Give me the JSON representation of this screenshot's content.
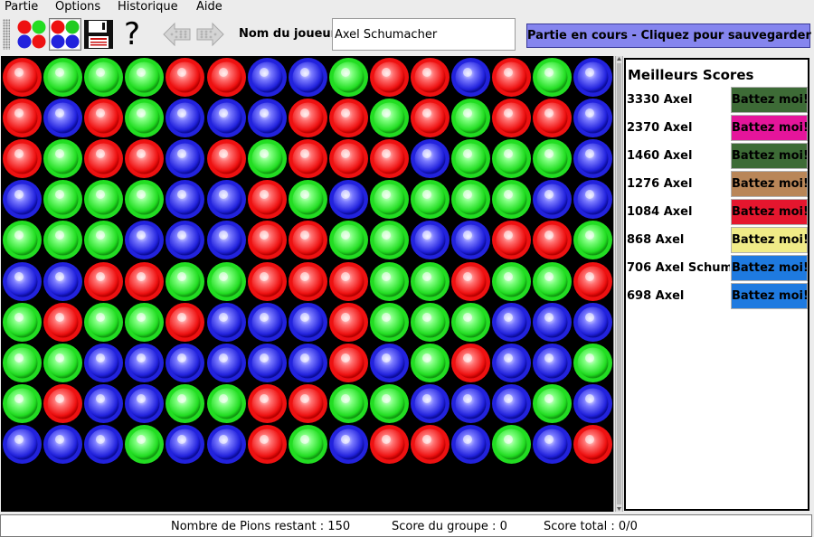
{
  "menu": [
    "Partie",
    "Options",
    "Historique",
    "Aide"
  ],
  "toolbar": {
    "player_label": "Nom du joueur",
    "player_name": "Axel Schumacher",
    "status_button": "Partie en cours - Cliquez pour sauvegarder",
    "help_glyph": "?"
  },
  "icons": {
    "new_game": "colored-balls-icon",
    "options": "color-grid-icon",
    "save": "floppy-disk-icon",
    "help": "question-mark-icon",
    "undo": "arrow-left-icon",
    "redo": "arrow-right-icon"
  },
  "colors": {
    "R": "#ee1111",
    "G": "#22dd22",
    "B": "#2222dd",
    "status_button_bg": "#8585ee"
  },
  "board": {
    "columns": 15,
    "rows": [
      "RGGGRRBBGRRBRGB",
      "RBRGBBBRRGRGRRB",
      "RGRRBRGRRRBGGGB",
      "BGGGBBRGBGGGGBB",
      "GGGBBBRRGGBBRRG",
      "BBRRGGRRRGGRGGR",
      "GRGGRBBBRGGGBBB",
      "GGBBBBBBRBGRBBG",
      "GRBBGGRRGGBBBGB",
      "BBBGBBRGBRRBGBR"
    ]
  },
  "scores": {
    "title": "Meilleurs Scores",
    "entries": [
      {
        "text": "3330 Axel",
        "button": "Battez moi!",
        "color": "#3d6b36"
      },
      {
        "text": "2370 Axel",
        "button": "Battez moi!",
        "color": "#e5159b"
      },
      {
        "text": "1460 Axel",
        "button": "Battez moi!",
        "color": "#3d6b36"
      },
      {
        "text": "1276 Axel",
        "button": "Battez moi!",
        "color": "#b98658"
      },
      {
        "text": "1084 Axel",
        "button": "Battez moi!",
        "color": "#e5162e"
      },
      {
        "text": "868 Axel",
        "button": "Battez moi!",
        "color": "#f0eb87"
      },
      {
        "text": "706 Axel Schum",
        "button": "Battez moi!",
        "color": "#1e7ae0"
      },
      {
        "text": "698 Axel",
        "button": "Battez moi!",
        "color": "#1e7ae0"
      }
    ]
  },
  "status": {
    "remaining": "Nombre de Pions restant : 150",
    "group_score": "Score du groupe : 0",
    "total_score": "Score total : 0/0"
  }
}
